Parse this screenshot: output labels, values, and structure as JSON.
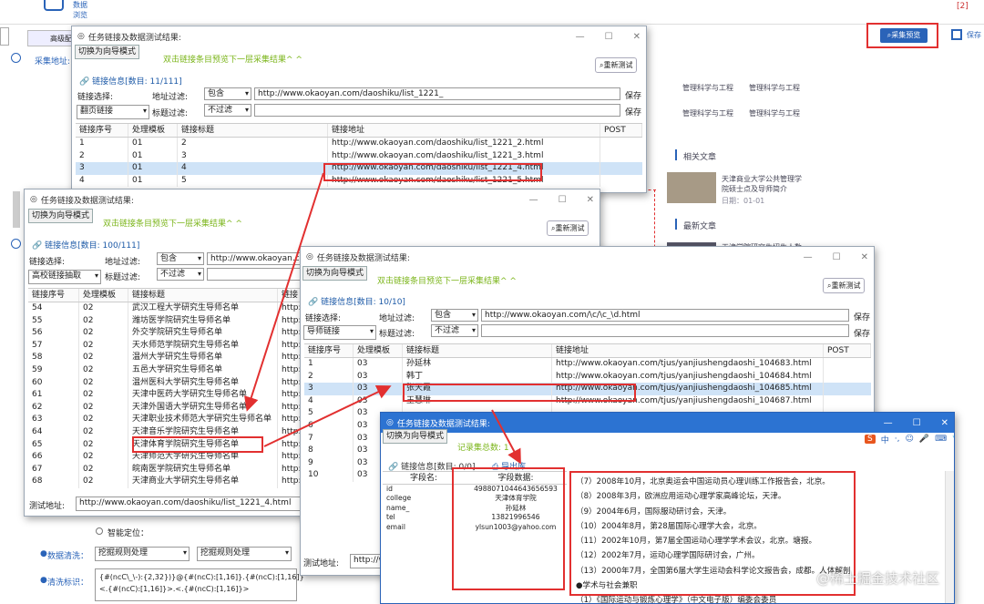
{
  "bg": {
    "nav_label": "数据\n浏览",
    "top_right_badge": "[2]",
    "adv_label": "高级配",
    "collect_url_label": "采集地址:",
    "btn_preview": "采集预览",
    "btn_save": "保存",
    "tags": [
      "管理科学与工程",
      "管理科学与工程",
      "管理科学与工程",
      "管理科学与工程"
    ],
    "related_title": "相关文章",
    "article_title": "天津商业大学公共管理学院硕士点及导师简介",
    "article_date": "日期：01-01",
    "latest_title": "最新文章",
    "latest_snip": "天津学院研究生招生人数",
    "smart_locate": "智能定位：",
    "clean_label": "数据清洗：",
    "clean_opt1": "挖掘规则处理",
    "clean_opt2": "挖掘规则处理",
    "clean_mark_label": "清洗标识：",
    "clean_rule_line1": "{#(ncC\\_\\-):{2,32})}@{#(ncC):[1,16]}.{#(ncC):[1,16]}",
    "clean_rule_line2": "<.{#(ncC):[1,16]}>.<.{#(ncC):[1,16]}>"
  },
  "win1": {
    "title": "任务链接及数据测试结果:",
    "switch": "切换为向导模式",
    "hint": "双击链接条目预览下一层采集结果^ ^",
    "refresh": "重新测试",
    "tab": "链接信息[数目: 11/111]",
    "link_select": "链接选择:",
    "addr_filter": "地址过滤:",
    "addr_mode": "包含",
    "addr_val": "http://www.okaoyan.com/daoshiku/list_1221_",
    "save": "保存",
    "type_sel": "翻页链接",
    "title_filter": "标题过滤:",
    "title_mode": "不过滤",
    "cols": [
      "链接序号",
      "处理模板",
      "链接标题",
      "链接地址",
      "POST"
    ],
    "rows": [
      [
        "1",
        "01",
        "2",
        "http://www.okaoyan.com/daoshiku/list_1221_2.html"
      ],
      [
        "2",
        "01",
        "3",
        "http://www.okaoyan.com/daoshiku/list_1221_3.html"
      ],
      [
        "3",
        "01",
        "4",
        "http://www.okaoyan.com/daoshiku/list_1221_4.html"
      ],
      [
        "4",
        "01",
        "5",
        "http://www.okaoyan.com/daoshiku/list_1221_5.html"
      ]
    ]
  },
  "win2": {
    "title": "任务链接及数据测试结果:",
    "switch": "切换为向导模式",
    "hint": "双击链接条目预览下一层采集结果^ ^",
    "refresh": "重新测试",
    "tab": "链接信息[数目: 100/111]",
    "link_select": "链接选择:",
    "addr_filter": "地址过滤:",
    "addr_mode": "包含",
    "addr_val": "http://www.okaoyan.co",
    "type_sel": "高校链接抽取",
    "title_filter": "标题过滤:",
    "title_mode": "不过滤",
    "cols": [
      "链接序号",
      "处理模板",
      "链接标题",
      "链接"
    ],
    "rows": [
      [
        "54",
        "02",
        "武汉工程大学研究生导师名单",
        "http:"
      ],
      [
        "55",
        "02",
        "潍坊医学院研究生导师名单",
        "http:"
      ],
      [
        "56",
        "02",
        "外交学院研究生导师名单",
        "http:"
      ],
      [
        "57",
        "02",
        "天水师范学院研究生导师名单",
        "http:"
      ],
      [
        "58",
        "02",
        "温州大学研究生导师名单",
        "http:"
      ],
      [
        "59",
        "02",
        "五邑大学研究生导师名单",
        "http:"
      ],
      [
        "60",
        "02",
        "温州医科大学研究生导师名单",
        "http:"
      ],
      [
        "61",
        "02",
        "天津中医药大学研究生导师名单",
        "http:"
      ],
      [
        "62",
        "02",
        "天津外国语大学研究生导师名单",
        "http:"
      ],
      [
        "63",
        "02",
        "天津职业技术师范大学研究生导师名单",
        "http:"
      ],
      [
        "64",
        "02",
        "天津音乐学院研究生导师名单",
        "http:"
      ],
      [
        "65",
        "02",
        "天津体育学院研究生导师名单",
        "http:"
      ],
      [
        "66",
        "02",
        "天津师范大学研究生导师名单",
        "http:"
      ],
      [
        "67",
        "02",
        "皖南医学院研究生导师名单",
        "http:"
      ],
      [
        "68",
        "02",
        "天津商业大学研究生导师名单",
        "http:"
      ]
    ],
    "test_addr_label": "测试地址:",
    "test_addr": "http://www.okaoyan.com/daoshiku/list_1221_4.html"
  },
  "win3": {
    "title": "任务链接及数据测试结果:",
    "switch": "切换为向导模式",
    "hint": "双击链接条目预览下一层采集结果^ ^",
    "refresh": "重新测试",
    "tab": "链接信息[数目: 10/10]",
    "link_select": "链接选择:",
    "addr_filter": "地址过滤:",
    "addr_mode": "包含",
    "addr_val": "http://www.okaoyan.com/\\c/\\c_\\d.html",
    "save": "保存",
    "type_sel": "导师链接",
    "title_filter": "标题过滤:",
    "title_mode": "不过滤",
    "cols": [
      "链接序号",
      "处理模板",
      "链接标题",
      "链接地址",
      "POST"
    ],
    "rows": [
      [
        "1",
        "03",
        "孙延林",
        "http://www.okaoyan.com/tjus/yanjiushengdaoshi_104683.html"
      ],
      [
        "2",
        "03",
        "韩丁",
        "http://www.okaoyan.com/tjus/yanjiushengdaoshi_104684.html"
      ],
      [
        "3",
        "03",
        "张天霞",
        "http://www.okaoyan.com/tjus/yanjiushengdaoshi_104685.html"
      ],
      [
        "4",
        "03",
        "王慧琳",
        "http://www.okaoyan.com/tjus/yanjiushengdaoshi_104687.html"
      ],
      [
        "5",
        "03",
        "",
        ""
      ],
      [
        "6",
        "03",
        "",
        ""
      ],
      [
        "7",
        "03",
        "",
        ""
      ],
      [
        "8",
        "03",
        "",
        ""
      ],
      [
        "9",
        "03",
        "",
        ""
      ],
      [
        "10",
        "03",
        "",
        ""
      ]
    ],
    "test_addr_label": "测试地址:",
    "test_addr": "http://w"
  },
  "win4": {
    "title": "任务链接及数据测试结果:",
    "switch": "切换为向导模式",
    "record_count": "记录集总数: 1",
    "tab": "链接信息[数目: 0/0]",
    "export": "导出库",
    "cols": [
      "字段名:",
      "字段数据:"
    ],
    "fields": [
      [
        "id",
        "4988071044643656593"
      ],
      [
        "college",
        "天津体育学院"
      ],
      [
        "name_",
        "孙延林"
      ],
      [
        "tel",
        "13821996546"
      ],
      [
        "email",
        "ylsun1003@yahoo.com"
      ]
    ],
    "text_lines": [
      "（7）2008年10月，北京奥运会中国运动员心理训练工作报告会，北京。",
      "（8）2008年3月，欧洲应用运动心理学家高峰论坛，天津。",
      "（9）2004年6月，国际服动研讨会，天津。",
      "（10）2004年8月，第28届国际心理学大会，北京。",
      "（11）2002年10月，第7届全国运动心理学学术会议，北京。塘报。",
      "（12）2002年7月，运动心理学国际研讨会，广州。",
      "（13）2000年7月，全国第6届大学生运动会科学论文报告会，成都。人体解剖",
      "●学术与社会兼职",
      "（1）《国际运动与锻炼心理学》（中文电子版）编委会委员"
    ]
  },
  "ime": {
    "items": [
      "中",
      "·,",
      "☺",
      "🎤",
      "⌨",
      "👕",
      "☷"
    ]
  },
  "watermark": "@稀土掘金技术社区"
}
